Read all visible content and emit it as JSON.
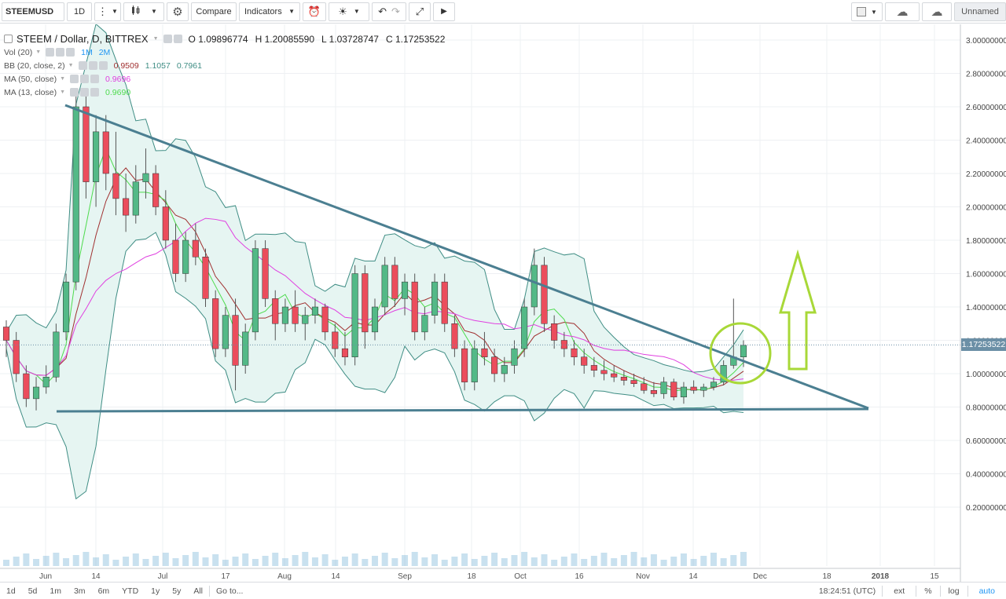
{
  "toolbar": {
    "symbol": "STEEMUSD",
    "interval": "1D",
    "compare": "Compare",
    "indicators": "Indicators",
    "layout_name": "Unnamed"
  },
  "legend": {
    "title": "STEEM / Dollar, D, BITTREX",
    "open": "O 1.09896774",
    "high": "H 1.20085590",
    "low": "L 1.03728747",
    "close": "C 1.17253522",
    "vol_label": "Vol (20)",
    "vol_values": [
      "1M",
      "2M"
    ],
    "bb_label": "BB (20, close, 2)",
    "bb_values": [
      "0.9509",
      "1.1057",
      "0.7961"
    ],
    "ma50_label": "MA (50, close)",
    "ma50_value": "0.9696",
    "ma13_label": "MA (13, close)",
    "ma13_value": "0.9690"
  },
  "price_tag": "1.17253522",
  "bottom": {
    "ranges": [
      "1d",
      "5d",
      "1m",
      "3m",
      "6m",
      "YTD",
      "1y",
      "5y",
      "All"
    ],
    "goto": "Go to...",
    "time": "18:24:51 (UTC)",
    "ext": "ext",
    "pct": "%",
    "log": "log",
    "auto": "auto"
  },
  "colors": {
    "up": "#53b987",
    "down": "#eb4d5c",
    "trendline": "#4b7f91",
    "bb_fill": "#e6f5f2",
    "bb_line": "#3f8d84",
    "ma50": "#e040e0",
    "ma13": "#4ddb4d",
    "ma_basis": "#a03030",
    "annotation": "#a8d838"
  },
  "chart_data": {
    "type": "candlestick",
    "title": "STEEM / Dollar, D, BITTREX",
    "y_ticks": [
      "3.00000000",
      "2.80000000",
      "2.60000000",
      "2.40000000",
      "2.20000000",
      "2.00000000",
      "1.80000000",
      "1.60000000",
      "1.40000000",
      "1.20000000",
      "1.00000000",
      "0.80000000",
      "0.60000000",
      "0.40000000",
      "0.20000000"
    ],
    "x_ticks": [
      "Jun",
      "14",
      "Jul",
      "17",
      "Aug",
      "14",
      "Sep",
      "18",
      "Oct",
      "16",
      "Nov",
      "14",
      "Dec",
      "18",
      "2018",
      "15"
    ],
    "ylim": [
      0.0,
      3.0
    ],
    "last_price": 1.17253522,
    "candles": [
      [
        1.28,
        1.32,
        1.1,
        1.2
      ],
      [
        1.2,
        1.25,
        0.95,
        1.0
      ],
      [
        1.0,
        1.05,
        0.8,
        0.85
      ],
      [
        0.85,
        0.98,
        0.78,
        0.92
      ],
      [
        0.92,
        1.05,
        0.88,
        0.98
      ],
      [
        0.98,
        1.3,
        0.95,
        1.25
      ],
      [
        1.25,
        1.6,
        1.2,
        1.55
      ],
      [
        1.55,
        2.7,
        1.5,
        2.6
      ],
      [
        2.6,
        2.7,
        2.05,
        2.15
      ],
      [
        2.15,
        2.55,
        2.0,
        2.45
      ],
      [
        2.45,
        2.55,
        2.1,
        2.2
      ],
      [
        2.2,
        2.45,
        1.95,
        2.05
      ],
      [
        2.05,
        2.2,
        1.85,
        1.95
      ],
      [
        1.95,
        2.25,
        1.9,
        2.15
      ],
      [
        2.15,
        2.35,
        2.05,
        2.2
      ],
      [
        2.2,
        2.25,
        1.95,
        2.0
      ],
      [
        2.0,
        2.1,
        1.75,
        1.8
      ],
      [
        1.8,
        1.9,
        1.55,
        1.6
      ],
      [
        1.6,
        1.85,
        1.55,
        1.8
      ],
      [
        1.8,
        1.9,
        1.65,
        1.7
      ],
      [
        1.7,
        1.75,
        1.4,
        1.45
      ],
      [
        1.45,
        1.5,
        1.1,
        1.15
      ],
      [
        1.15,
        1.4,
        1.1,
        1.35
      ],
      [
        1.35,
        1.45,
        0.9,
        1.05
      ],
      [
        1.05,
        1.3,
        1.0,
        1.25
      ],
      [
        1.25,
        1.8,
        1.2,
        1.75
      ],
      [
        1.75,
        1.8,
        1.4,
        1.45
      ],
      [
        1.45,
        1.5,
        1.2,
        1.3
      ],
      [
        1.3,
        1.45,
        1.25,
        1.4
      ],
      [
        1.4,
        1.5,
        1.25,
        1.3
      ],
      [
        1.3,
        1.4,
        1.2,
        1.35
      ],
      [
        1.35,
        1.45,
        1.3,
        1.4
      ],
      [
        1.4,
        1.42,
        1.2,
        1.25
      ],
      [
        1.25,
        1.3,
        1.1,
        1.15
      ],
      [
        1.15,
        1.25,
        1.05,
        1.1
      ],
      [
        1.1,
        1.65,
        1.05,
        1.6
      ],
      [
        1.6,
        1.65,
        1.15,
        1.25
      ],
      [
        1.25,
        1.45,
        1.2,
        1.4
      ],
      [
        1.4,
        1.7,
        1.35,
        1.65
      ],
      [
        1.65,
        1.7,
        1.4,
        1.45
      ],
      [
        1.45,
        1.6,
        1.35,
        1.55
      ],
      [
        1.55,
        1.6,
        1.2,
        1.25
      ],
      [
        1.25,
        1.4,
        1.2,
        1.35
      ],
      [
        1.35,
        1.6,
        1.3,
        1.55
      ],
      [
        1.55,
        1.6,
        1.25,
        1.3
      ],
      [
        1.3,
        1.35,
        1.1,
        1.15
      ],
      [
        1.15,
        1.2,
        0.9,
        0.95
      ],
      [
        0.95,
        1.2,
        0.9,
        1.15
      ],
      [
        1.15,
        1.25,
        1.05,
        1.1
      ],
      [
        1.1,
        1.15,
        0.95,
        1.0
      ],
      [
        1.0,
        1.1,
        0.95,
        1.05
      ],
      [
        1.05,
        1.2,
        1.0,
        1.15
      ],
      [
        1.15,
        1.45,
        1.1,
        1.4
      ],
      [
        1.4,
        1.75,
        1.35,
        1.65
      ],
      [
        1.65,
        1.7,
        1.25,
        1.3
      ],
      [
        1.3,
        1.35,
        1.15,
        1.2
      ],
      [
        1.2,
        1.25,
        1.1,
        1.15
      ],
      [
        1.15,
        1.2,
        1.05,
        1.1
      ],
      [
        1.1,
        1.15,
        1.0,
        1.05
      ],
      [
        1.05,
        1.1,
        0.98,
        1.02
      ],
      [
        1.02,
        1.08,
        0.96,
        1.0
      ],
      [
        1.0,
        1.05,
        0.95,
        0.98
      ],
      [
        0.98,
        1.02,
        0.93,
        0.96
      ],
      [
        0.96,
        1.0,
        0.92,
        0.94
      ],
      [
        0.94,
        0.98,
        0.88,
        0.9
      ],
      [
        0.9,
        0.95,
        0.86,
        0.88
      ],
      [
        0.88,
        0.98,
        0.85,
        0.95
      ],
      [
        0.95,
        0.97,
        0.84,
        0.86
      ],
      [
        0.86,
        0.95,
        0.82,
        0.92
      ],
      [
        0.92,
        0.96,
        0.88,
        0.9
      ],
      [
        0.9,
        0.94,
        0.86,
        0.92
      ],
      [
        0.92,
        0.98,
        0.9,
        0.95
      ],
      [
        0.95,
        1.08,
        0.93,
        1.05
      ],
      [
        1.05,
        1.45,
        1.03,
        1.1
      ],
      [
        1.1,
        1.2,
        1.04,
        1.17
      ]
    ]
  }
}
